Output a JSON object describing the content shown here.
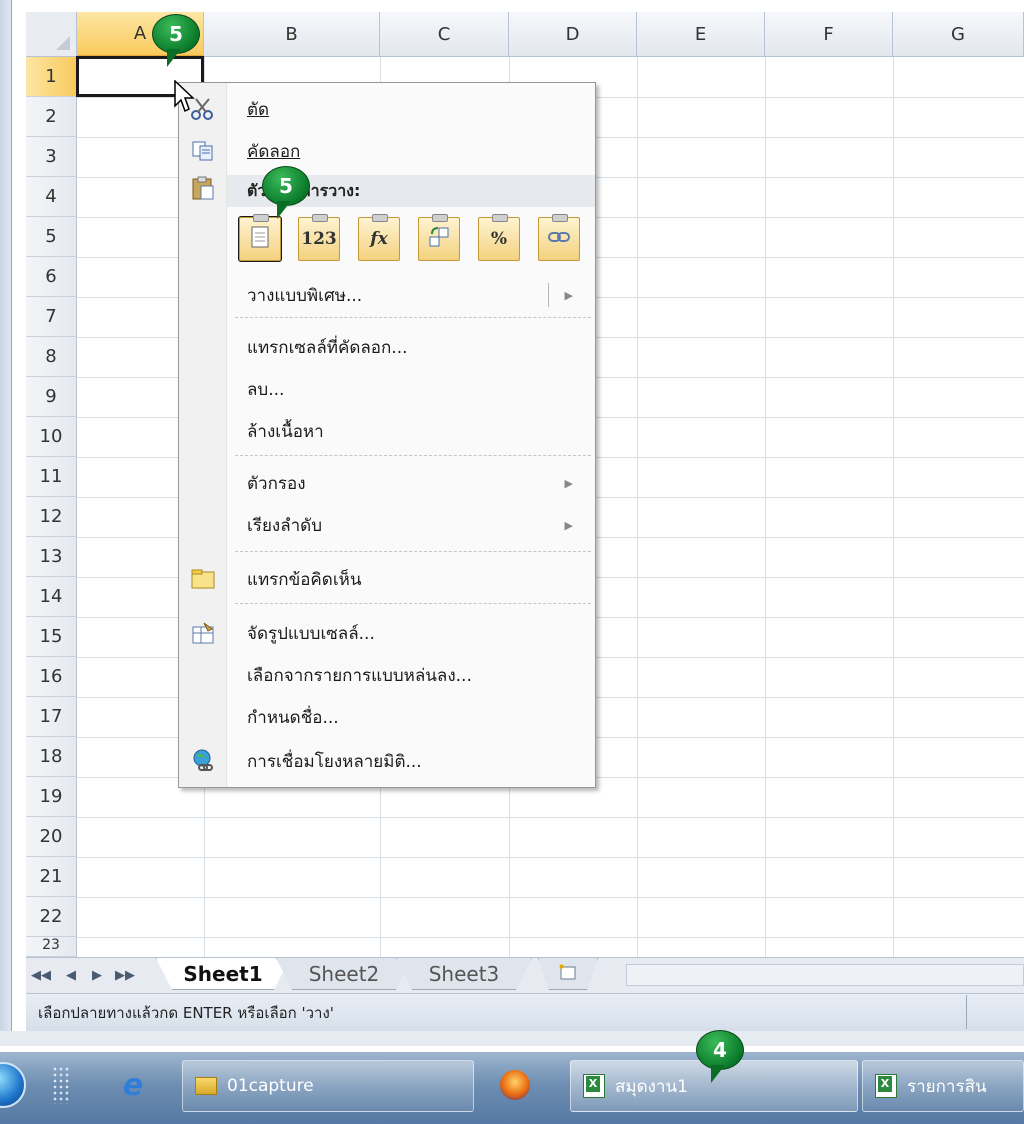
{
  "columns": [
    {
      "label": "A",
      "selected": true
    },
    {
      "label": "B"
    },
    {
      "label": "C"
    },
    {
      "label": "D"
    },
    {
      "label": "E"
    },
    {
      "label": "F"
    },
    {
      "label": "G"
    }
  ],
  "rows": [
    "1",
    "2",
    "3",
    "4",
    "5",
    "6",
    "7",
    "8",
    "9",
    "10",
    "11",
    "12",
    "13",
    "14",
    "15",
    "16",
    "17",
    "18",
    "19",
    "20",
    "21",
    "22",
    "23"
  ],
  "context_menu": {
    "cut": "ตัด",
    "copy": "คัดลอก",
    "paste_options_header": "ตัวเลือกการวาง:",
    "paste_buttons": [
      {
        "icon": "paste-icon",
        "label": ""
      },
      {
        "icon": "paste-values-icon",
        "label": "123"
      },
      {
        "icon": "paste-formulas-icon",
        "label": "fx"
      },
      {
        "icon": "paste-transpose-icon",
        "label": ""
      },
      {
        "icon": "paste-formatting-icon",
        "label": "%"
      },
      {
        "icon": "paste-link-icon",
        "label": ""
      }
    ],
    "paste_special": "วางแบบพิเศษ...",
    "insert_copied_cells": "แทรกเซลล์ที่คัดลอก...",
    "delete": "ลบ...",
    "clear_contents": "ล้างเนื้อหา",
    "filter": "ตัวกรอง",
    "sort": "เรียงลำดับ",
    "insert_comment": "แทรกข้อคิดเห็น",
    "format_cells": "จัดรูปแบบเซลล์...",
    "pick_from_list": "เลือกจากรายการแบบหล่นลง...",
    "define_name": "กำหนดชื่อ...",
    "hyperlink": "การเชื่อมโยงหลายมิติ..."
  },
  "sheet_tabs": {
    "nav": [
      "◀◀",
      "◀",
      "▶",
      "▶▶"
    ],
    "tabs": [
      {
        "label": "Sheet1",
        "active": true
      },
      {
        "label": "Sheet2"
      },
      {
        "label": "Sheet3"
      }
    ],
    "new_sheet_icon": "new-sheet-icon"
  },
  "status_bar": {
    "message": "เลือกปลายทางแล้วกด ENTER หรือเลือก 'วาง'"
  },
  "taskbar": {
    "items": [
      {
        "icon": "folder-icon",
        "label": "01capture"
      },
      {
        "icon": "excel-icon",
        "label": "สมุดงาน1",
        "active": true
      },
      {
        "icon": "excel-icon",
        "label": "รายการสิน"
      }
    ]
  },
  "callouts": {
    "column_a": "5",
    "paste_button": "5",
    "taskbar": "4"
  },
  "colors": {
    "selection_header": "#f8ca5c",
    "callout_green": "#0a7a2a",
    "taskbar": "#6e8eb2"
  }
}
